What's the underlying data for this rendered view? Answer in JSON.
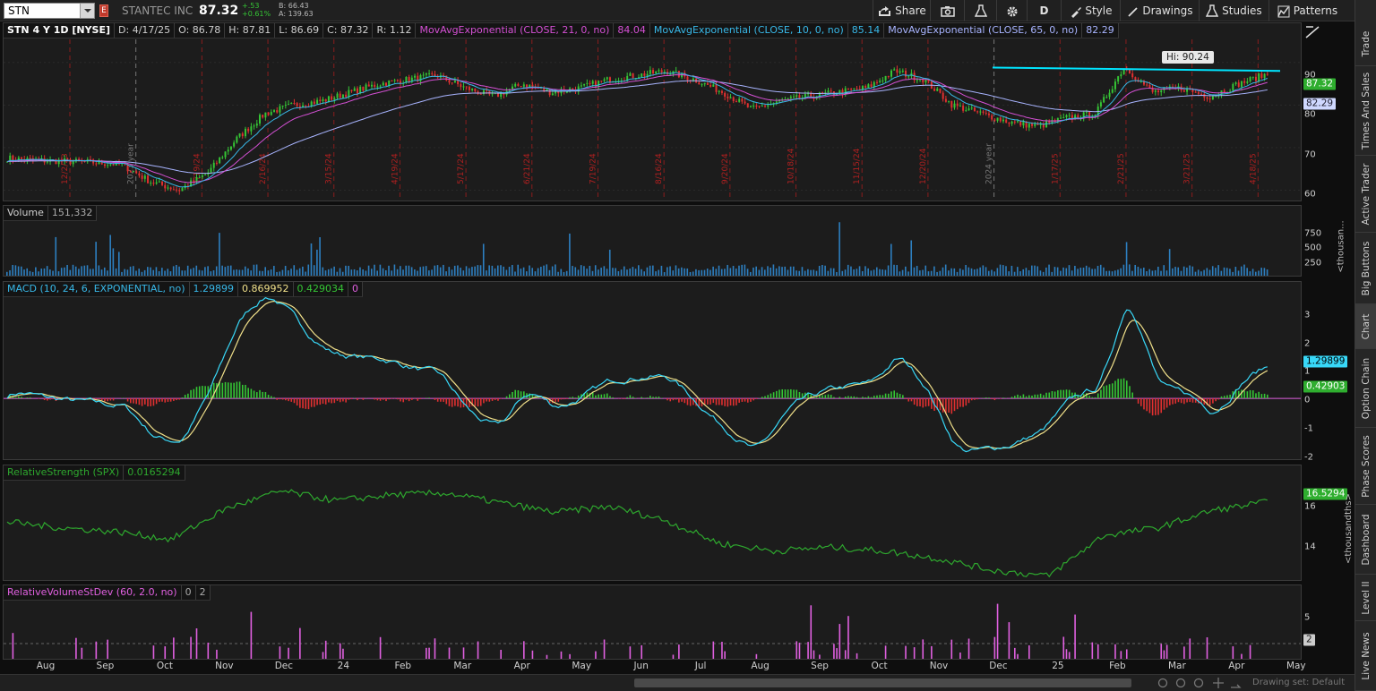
{
  "toolbar": {
    "symbol": "STN",
    "flag": "E",
    "company": "STANTEC INC",
    "last": "87.32",
    "change": "+.53",
    "change_pct": "+0.61%",
    "bid": "B: 66.43",
    "ask": "A: 139.63",
    "share": "Share",
    "period": "D",
    "style": "Style",
    "drawings": "Drawings",
    "studies": "Studies",
    "patterns": "Patterns"
  },
  "side_tabs": [
    "Trade",
    "Times And Sales",
    "Active Trader",
    "Big Buttons",
    "Chart",
    "Option Chain",
    "Phase Scores",
    "Dashboard",
    "Level II",
    "Live News"
  ],
  "price_panel": {
    "legend": [
      "STN 4 Y 1D [NYSE]",
      "D: 4/17/25",
      "O: 86.78",
      "H: 87.81",
      "L: 86.69",
      "C: 87.32",
      "R: 1.12"
    ],
    "ma": [
      {
        "label": "MovAvgExponential (CLOSE, 21, 0, no)",
        "value": "84.04",
        "color": "#d450d4"
      },
      {
        "label": "MovAvgExponential (CLOSE, 10, 0, no)",
        "value": "85.14",
        "color": "#38b8e8"
      },
      {
        "label": "MovAvgExponential (CLOSE, 65, 0, no)",
        "value": "82.29",
        "color": "#a8b4ff"
      }
    ],
    "ticks": [
      "90",
      "80",
      "70",
      "60"
    ],
    "tag_close": "87.32",
    "tag_ma65": "82.29",
    "hi_label": "Hi: 90.24",
    "period_lines": [
      "12/2/23",
      "2023 year",
      "1/19/24",
      "2/16/24",
      "3/15/24",
      "4/19/24",
      "5/17/24",
      "6/21/24",
      "7/19/24",
      "8/16/24",
      "9/20/24",
      "10/18/24",
      "11/15/24",
      "12/20/24",
      "2024 year",
      "1/17/25",
      "2/21/25",
      "3/21/25",
      "4/18/25"
    ]
  },
  "volume_panel": {
    "legend": [
      "Volume",
      "151,332"
    ],
    "ticks": [
      "750",
      "500",
      "250"
    ],
    "axis_label": "<thousan..."
  },
  "macd_panel": {
    "legend": [
      "MACD (10, 24, 6, EXPONENTIAL, no)",
      "1.29899",
      "0.869952",
      "0.429034",
      "0"
    ],
    "ticks": [
      "3",
      "2",
      "1",
      "0",
      "-1",
      "-2"
    ],
    "tag_value": "1.29899",
    "tag_diff": "0.42903"
  },
  "rs_panel": {
    "legend": [
      "RelativeStrength (SPX)",
      "0.0165294"
    ],
    "ticks": [
      "16",
      "14"
    ],
    "tag_value": "16.5294",
    "axis_label": "<thousandths>"
  },
  "rv_panel": {
    "legend": [
      "RelativeVolumeStDev (60, 2.0, no)",
      "0",
      "2"
    ],
    "ticks": [
      "5",
      "0"
    ],
    "tag_value": "2"
  },
  "time_axis": [
    "Aug",
    "Sep",
    "Oct",
    "Nov",
    "Dec",
    "24",
    "Feb",
    "Mar",
    "Apr",
    "May",
    "Jun",
    "Jul",
    "Aug",
    "Sep",
    "Oct",
    "Nov",
    "Dec",
    "25",
    "Feb",
    "Mar",
    "Apr",
    "May"
  ],
  "bottom": {
    "drawing_set": "Drawing set: Default"
  },
  "colors": {
    "up": "#35c535",
    "down": "#e03030",
    "trendline": "#00e5ff",
    "rs_line": "#2ea82e",
    "rv_bar": "#e060e0",
    "volume_bar": "#2d7fc0"
  },
  "chart_data": {
    "type": "line",
    "title": "STN 4 Y 1D [NYSE]",
    "x_range": [
      "Jul 2023",
      "Apr 2025"
    ],
    "price_ylim": [
      58,
      95
    ],
    "series": [
      {
        "name": "MovAvgExponential (CLOSE, 10, 0, no)",
        "last": 85.14
      },
      {
        "name": "MovAvgExponential (CLOSE, 21, 0, no)",
        "last": 84.04
      },
      {
        "name": "MovAvgExponential (CLOSE, 65, 0, no)",
        "last": 82.29
      }
    ],
    "approx_close_path": [
      67.5,
      67,
      66.8,
      66.5,
      66,
      62,
      60,
      64,
      72,
      78,
      80,
      81,
      83,
      85,
      86,
      87,
      84,
      82,
      85,
      83,
      84,
      86,
      87,
      88,
      86,
      83,
      79,
      81,
      82,
      83,
      84,
      88,
      86,
      80,
      78,
      76,
      75,
      77,
      78,
      89,
      83,
      84,
      82,
      85,
      87.32
    ],
    "hi": 90.24,
    "macd_ylim": [
      -2.2,
      3.5
    ],
    "rs_ylim": [
      12.5,
      17.5
    ]
  }
}
